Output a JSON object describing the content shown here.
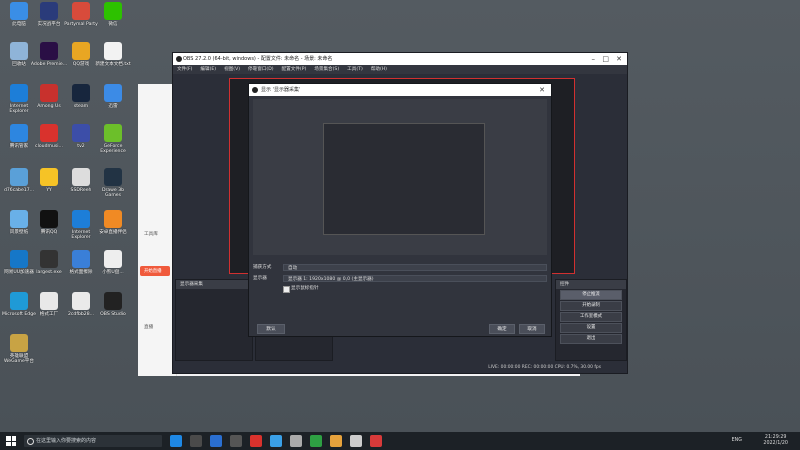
{
  "desktop": {
    "icons": [
      {
        "label": "此电脑",
        "color": "#3a8ee6"
      },
      {
        "label": "实况战平台",
        "color": "#2a3b7a"
      },
      {
        "label": "Partymal Party",
        "color": "#d84b3b"
      },
      {
        "label": "微信",
        "color": "#2dc100"
      },
      {
        "label": "回收站",
        "color": "#8fb4d8"
      },
      {
        "label": "Adobe Premie...",
        "color": "#2a0f45"
      },
      {
        "label": "QQ游戏",
        "color": "#e8a623"
      },
      {
        "label": "新建文本文档.txt",
        "color": "#f2f2f2"
      },
      {
        "label": "Internet Explorer",
        "color": "#1d7ed8"
      },
      {
        "label": "Among Us",
        "color": "#c8312d"
      },
      {
        "label": "steam",
        "color": "#17263d"
      },
      {
        "label": "迅雷",
        "color": "#3c8be6"
      },
      {
        "label": "腾讯管家",
        "color": "#2d86e0"
      },
      {
        "label": "cloudmusi...",
        "color": "#d9322d"
      },
      {
        "label": "tv2",
        "color": "#3c4ea8"
      },
      {
        "label": "GeForce Experience",
        "color": "#6cbf2a"
      },
      {
        "label": "d76cabe17...",
        "color": "#5aa0d8"
      },
      {
        "label": "YY",
        "color": "#f6c326"
      },
      {
        "label": "SSDReeh",
        "color": "#dddddd"
      },
      {
        "label": "Drawe 3b Games",
        "color": "#223344"
      },
      {
        "label": "风景壁纸",
        "color": "#69b0e8"
      },
      {
        "label": "腾讯QQ",
        "color": "#111111"
      },
      {
        "label": "Internet Explorer",
        "color": "#1d7ed8"
      },
      {
        "label": "安卓直播伴侣",
        "color": "#f08a24"
      },
      {
        "label": "网易UU加速器",
        "color": "#1677c8"
      },
      {
        "label": "largest.exe",
        "color": "#333333"
      },
      {
        "label": "格式面擦除",
        "color": "#3a7fd8"
      },
      {
        "label": "小熊U盘...",
        "color": "#eeeeee"
      },
      {
        "label": "Microsoft Edge",
        "color": "#1f9ad6"
      },
      {
        "label": "格式工厂",
        "color": "#e8e8e8"
      },
      {
        "label": "2cdfbb28...",
        "color": "#eaeaea"
      },
      {
        "label": "OBS Studio",
        "color": "#222222"
      },
      {
        "label": "英雄联盟WeGame平台",
        "color": "#c8a344"
      }
    ]
  },
  "taskbar": {
    "search_placeholder": "在这里输入你要搜索的内容",
    "apps": [
      "#1e88e5",
      "#4a4a4a",
      "#2a6fd1",
      "#555555",
      "#d9322d",
      "#3aa0e8",
      "#aaaaaa",
      "#2ea043",
      "#e6a23c",
      "#cccccc",
      "#d83a3a"
    ],
    "tray": "ENG",
    "time": "21:29:29",
    "date": "2022/1/20"
  },
  "obs": {
    "title": "OBS 27.2.0 (64-bit, windows) - 配置文件: 未命名 - 场景: 未命名",
    "menu": [
      "文件(F)",
      "编辑(E)",
      "视图(V)",
      "停靠窗口(D)",
      "配置文件(P)",
      "场景集合(S)",
      "工具(T)",
      "帮助(H)"
    ],
    "controls_header": "控件",
    "controls": [
      "停止推流",
      "开始录制",
      "工作室模式",
      "设置",
      "退出"
    ],
    "status": "LIVE: 00:00:00   REC: 00:00:00   CPU: 0.7%, 30.00 fps"
  },
  "dialog": {
    "title": "显示 '显示器采集'",
    "capture_label": "捕获方式",
    "capture_value": "自动",
    "display_label": "显示器",
    "display_value": "显示器 1: 1920x1080 @ 0,0 (主显示器)",
    "cursor_label": "显示鼠标指针",
    "defaults_btn": "默认",
    "ok_btn": "确定",
    "cancel_btn": "取消"
  },
  "bgapp": {
    "tabs": [
      "工具库",
      "直播",
      "开始直播"
    ]
  },
  "obs_panels": {
    "scenes_header": "显示器采集",
    "sources_header": "场景",
    "mixer_header": "混音器"
  }
}
